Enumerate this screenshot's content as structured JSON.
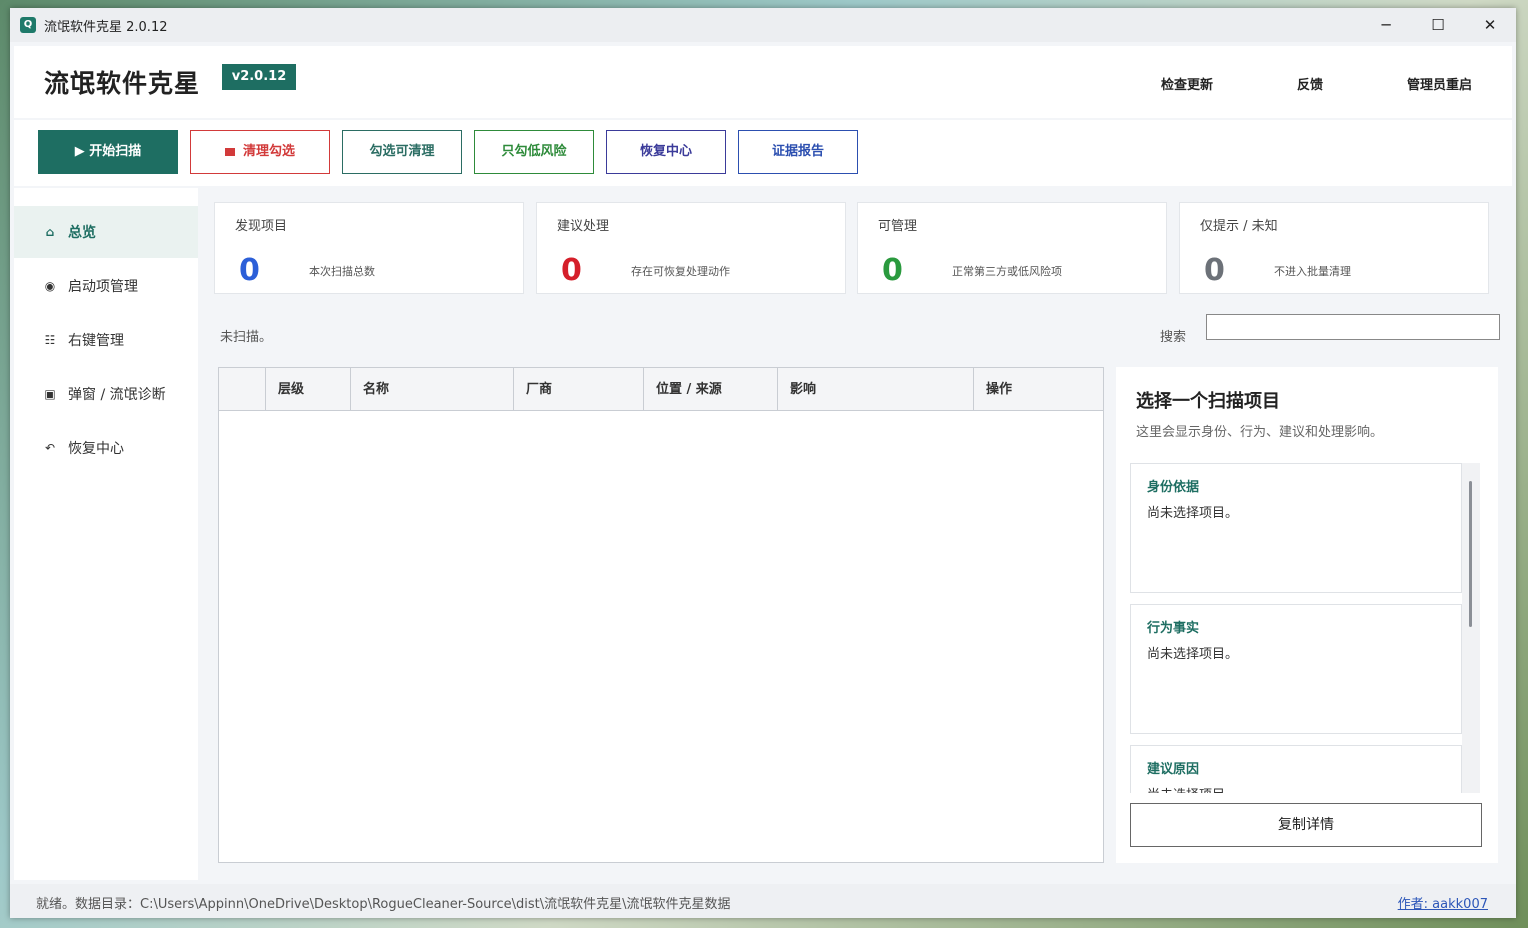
{
  "window": {
    "title": "流氓软件克星 2.0.12"
  },
  "header": {
    "brand": "流氓软件克星",
    "version": "v2.0.12",
    "links": [
      "检查更新",
      "反馈",
      "管理员重启"
    ]
  },
  "toolbar": {
    "buttons": [
      "▶ 开始扫描",
      "清理勾选",
      "勾选可清理",
      "只勾低风险",
      "恢复中心",
      "证据报告"
    ]
  },
  "sidebar": {
    "items": [
      "总览",
      "启动项管理",
      "右键管理",
      "弹窗 / 流氓诊断",
      "恢复中心"
    ]
  },
  "cards": [
    {
      "title": "发现项目",
      "value": "0",
      "desc": "本次扫描总数",
      "color": "#2c5fd8"
    },
    {
      "title": "建议处理",
      "value": "0",
      "desc": "存在可恢复处理动作",
      "color": "#d51f2a"
    },
    {
      "title": "可管理",
      "value": "0",
      "desc": "正常第三方或低风险项",
      "color": "#2a9a3e"
    },
    {
      "title": "仅提示 / 未知",
      "value": "0",
      "desc": "不进入批量清理",
      "color": "#6c7178"
    }
  ],
  "main": {
    "status": "未扫描。",
    "search_label": "搜索",
    "search_value": ""
  },
  "table": {
    "columns": [
      "",
      "层级",
      "名称",
      "厂商",
      "位置 / 来源",
      "影响",
      "操作"
    ],
    "rows": []
  },
  "detail": {
    "title": "选择一个扫描项目",
    "subtitle": "这里会显示身份、行为、建议和处理影响。",
    "sections": [
      {
        "heading": "身份依据",
        "body": "尚未选择项目。"
      },
      {
        "heading": "行为事实",
        "body": "尚未选择项目。"
      },
      {
        "heading": "建议原因",
        "body": "尚未选择项目。"
      }
    ],
    "copy_button": "复制详情"
  },
  "statusbar": {
    "text": "就绪。数据目录：C:\\Users\\Appinn\\OneDrive\\Desktop\\RogueCleaner-Source\\dist\\流氓软件克星\\流氓软件克星数据",
    "author": "作者: aakk007"
  }
}
